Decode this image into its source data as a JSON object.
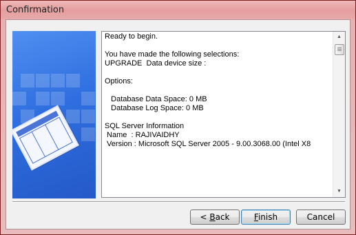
{
  "window": {
    "title": "Confirmation"
  },
  "summary_text": {
    "lines": [
      "Ready to begin.",
      "",
      "You have made the following selections:",
      "UPGRADE  Data device size :",
      "",
      "Options:",
      "",
      "   Database Data Space: 0 MB",
      "   Database Log Space: 0 MB",
      "",
      "SQL Server Information",
      " Name  : RAJIVAIDHY",
      " Version : Microsoft SQL Server 2005 - 9.00.3068.00 (Intel X8"
    ]
  },
  "scrollbar": {
    "up_arrow": "▲",
    "down_arrow": "▼"
  },
  "buttons": {
    "back_prefix": "< ",
    "back_mnemonic": "B",
    "back_rest": "ack",
    "finish_mnemonic": "F",
    "finish_rest": "inish",
    "cancel": "Cancel"
  }
}
